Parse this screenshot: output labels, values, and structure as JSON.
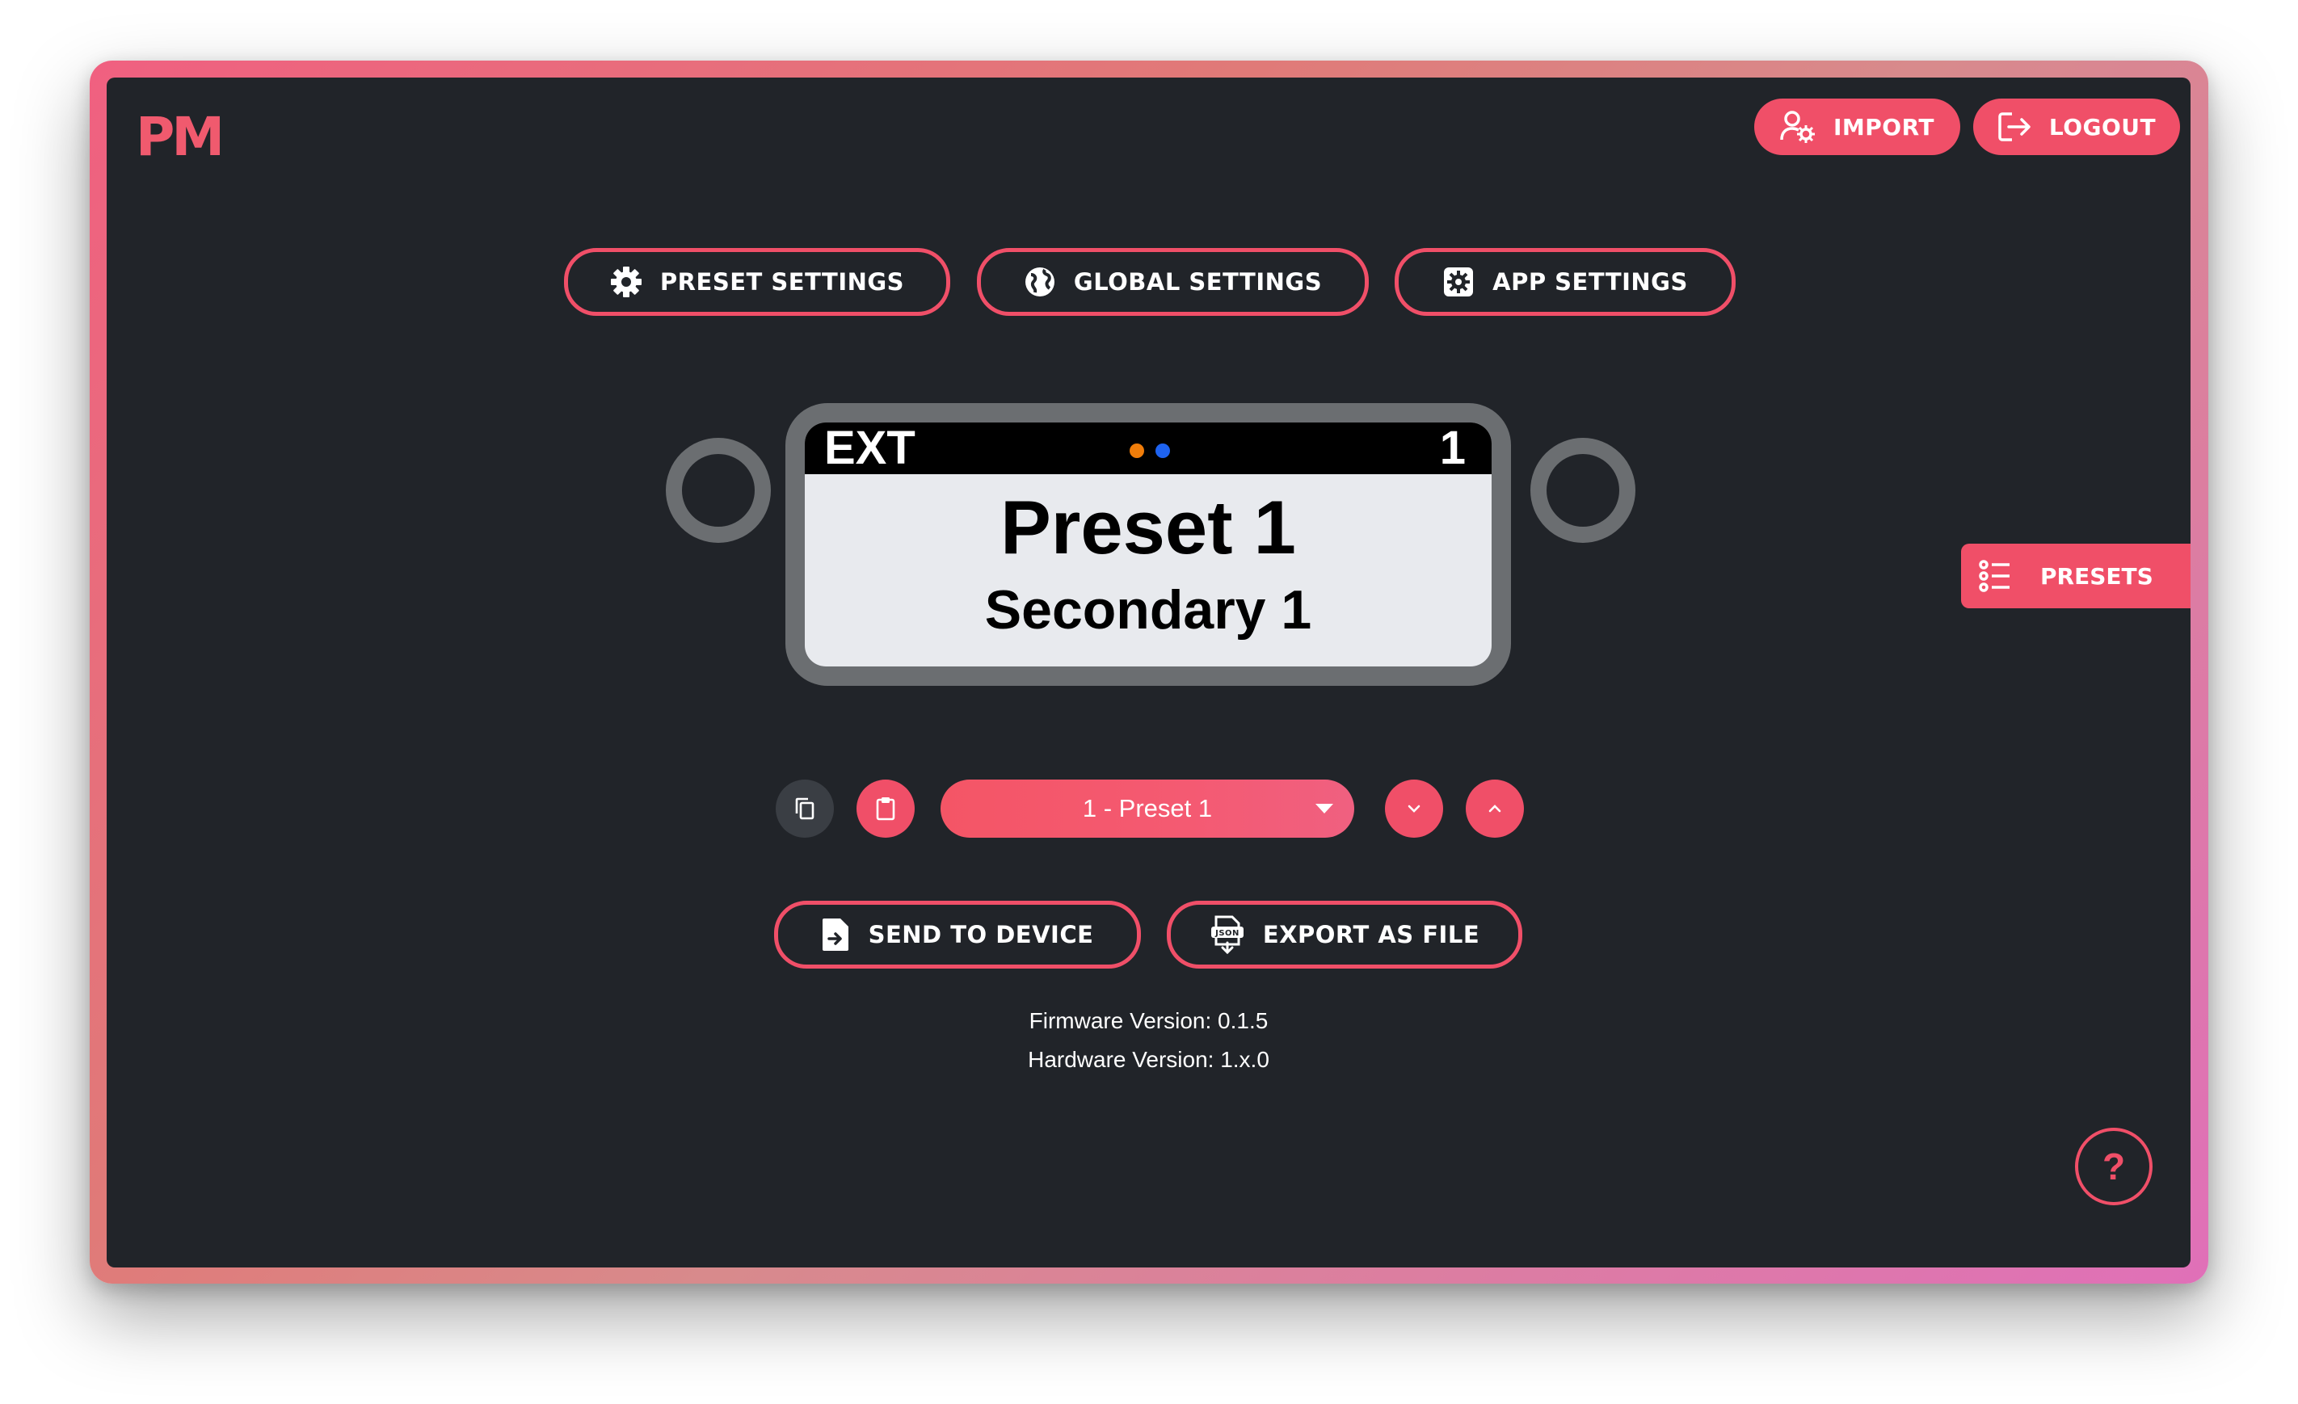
{
  "app": {
    "logo": "PM"
  },
  "header": {
    "import_label": "IMPORT",
    "logout_label": "LOGOUT"
  },
  "settings_tabs": [
    {
      "label": "PRESET SETTINGS",
      "icon": "gear-icon"
    },
    {
      "label": "GLOBAL SETTINGS",
      "icon": "globe-icon"
    },
    {
      "label": "APP SETTINGS",
      "icon": "app-settings-icon"
    }
  ],
  "device_screen": {
    "mode": "EXT",
    "bank_number": "1",
    "preset_name": "Preset 1",
    "secondary_name": "Secondary 1",
    "indicator_colors": [
      "#f07d0a",
      "#1e63f0"
    ]
  },
  "side_tab": {
    "label": "PRESETS",
    "icon": "list-icon"
  },
  "preset_selector": {
    "selected": "1 - Preset 1"
  },
  "actions": {
    "send_label": "SEND TO DEVICE",
    "export_label": "EXPORT AS FILE"
  },
  "versions": {
    "firmware": "Firmware Version: 0.1.5",
    "hardware": "Hardware Version: 1.x.0"
  },
  "help": {
    "label": "?"
  },
  "colors": {
    "accent": "#f04f68",
    "background": "#212429",
    "case": "#6b6e71"
  }
}
